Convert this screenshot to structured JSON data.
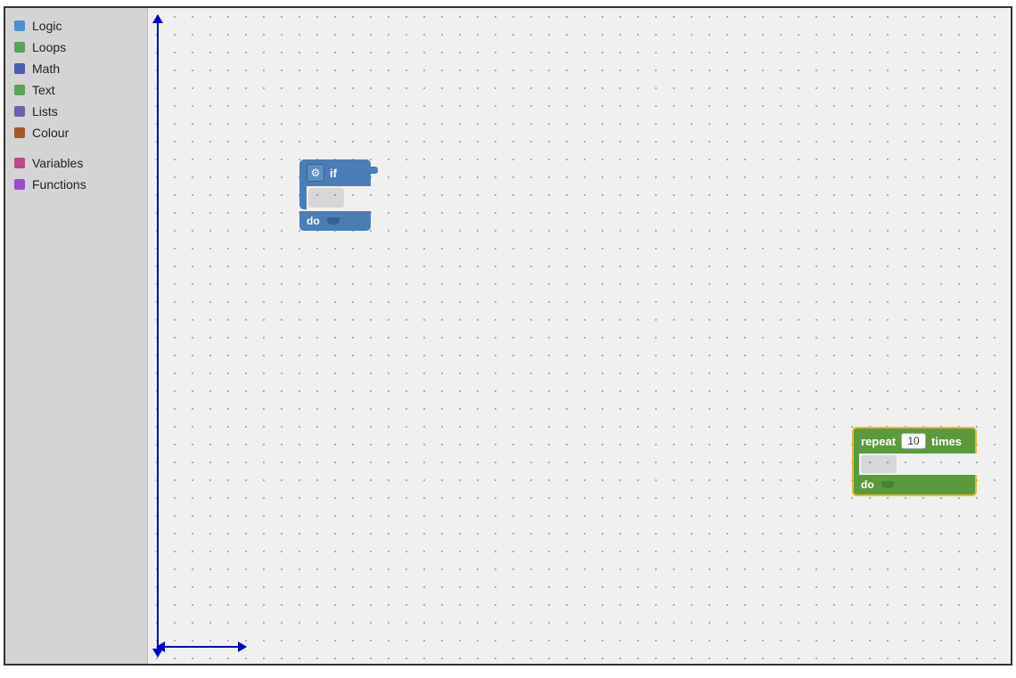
{
  "sidebar": {
    "items": [
      {
        "id": "logic",
        "label": "Logic",
        "color": "#4a90d9"
      },
      {
        "id": "loops",
        "label": "Loops",
        "color": "#5ba35b"
      },
      {
        "id": "math",
        "label": "Math",
        "color": "#4a5db0"
      },
      {
        "id": "text",
        "label": "Text",
        "color": "#5ba35b"
      },
      {
        "id": "lists",
        "label": "Lists",
        "color": "#7060a8"
      },
      {
        "id": "colour",
        "label": "Colour",
        "color": "#a05a2c"
      },
      {
        "id": "variables",
        "label": "Variables",
        "color": "#b84b8a"
      },
      {
        "id": "functions",
        "label": "Functions",
        "color": "#9b4fcc"
      }
    ]
  },
  "blocks": {
    "if_block": {
      "top_label": "if",
      "bottom_label": "do"
    },
    "repeat_block": {
      "label": "repeat",
      "value": "10",
      "suffix": "times",
      "bottom_label": "do"
    }
  },
  "arrows": {
    "vertical": "vertical-resize-arrow",
    "horizontal": "horizontal-resize-arrow"
  }
}
